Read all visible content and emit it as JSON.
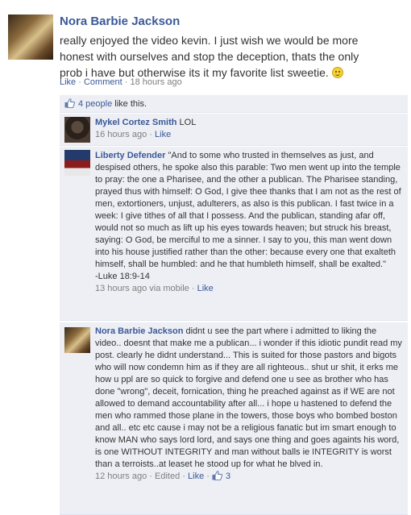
{
  "post": {
    "author": "Nora Barbie Jackson",
    "text": "really enjoyed the video kevin. I just wish we would be more honest with ourselves and stop the deception, thats the only prob i have but otherwise its it my favorite list sweetie.",
    "emoticon": "smiley-icon",
    "actions": {
      "like": "Like",
      "comment": "Comment",
      "separator": "·",
      "time": "18 hours ago"
    }
  },
  "likes": {
    "count_link": "4 people",
    "suffix": " like this."
  },
  "comments": [
    {
      "author": "Mykel Cortez Smith",
      "text": "LOL",
      "time": "16 hours ago",
      "like": "Like"
    },
    {
      "author": "Liberty Defender",
      "text": "\"And to some who trusted in themselves as just, and despised others, he spoke also this parable: Two men went up into the temple to pray: the one a Pharisee, and the other a publican. The Pharisee standing, prayed thus with himself: O God, I give thee thanks that I am not as the rest of men, extortioners, unjust, adulterers, as also is this publican. I fast twice in a week: I give tithes of all that I possess. And the publican, standing afar off, would not so much as lift up his eyes towards heaven; but struck his breast, saying: O God, be merciful to me a sinner. I say to you, this man went down into his house justified rather than the other: because every one that exalteth himself, shall be humbled: and he that humbleth himself, shall be exalted.\"",
      "citation": "-Luke 18:9-14",
      "time": "13 hours ago via mobile",
      "like": "Like"
    },
    {
      "author": "Nora Barbie Jackson",
      "text": "didnt u see the part where i admitted to liking the video.. doesnt that make me a publican... i wonder if this idiotic pundit read my post. clearly he didnt understand... This is suited for those pastors and bigots who will now condemn him as if they are all righteous.. shut ur shit, it erks me how u ppl are so quick to forgive and defend one u see as brother who has done \"wrong\", deceit, fornication, thing he preached against as if WE are not allowed to demand accountability after all... i hope u hastened to defend the men who rammed those plane in the towers, those boys who bombed boston and all.. etc etc cause i may not be a religious fanatic but im smart enough to know MAN who says lord lord, and says one thing and goes againts his word, is one WITHOUT INTEGRITY and man without balls ie INTEGRITY is worst than a terroists..at leaset he stood up for what he blved in.",
      "time": "12 hours ago",
      "edited": "Edited",
      "like": "Like",
      "like_count": "3"
    }
  ],
  "colors": {
    "link": "#3b5998",
    "meta": "#7f7f7f",
    "comment_bg": "#edeff4"
  }
}
